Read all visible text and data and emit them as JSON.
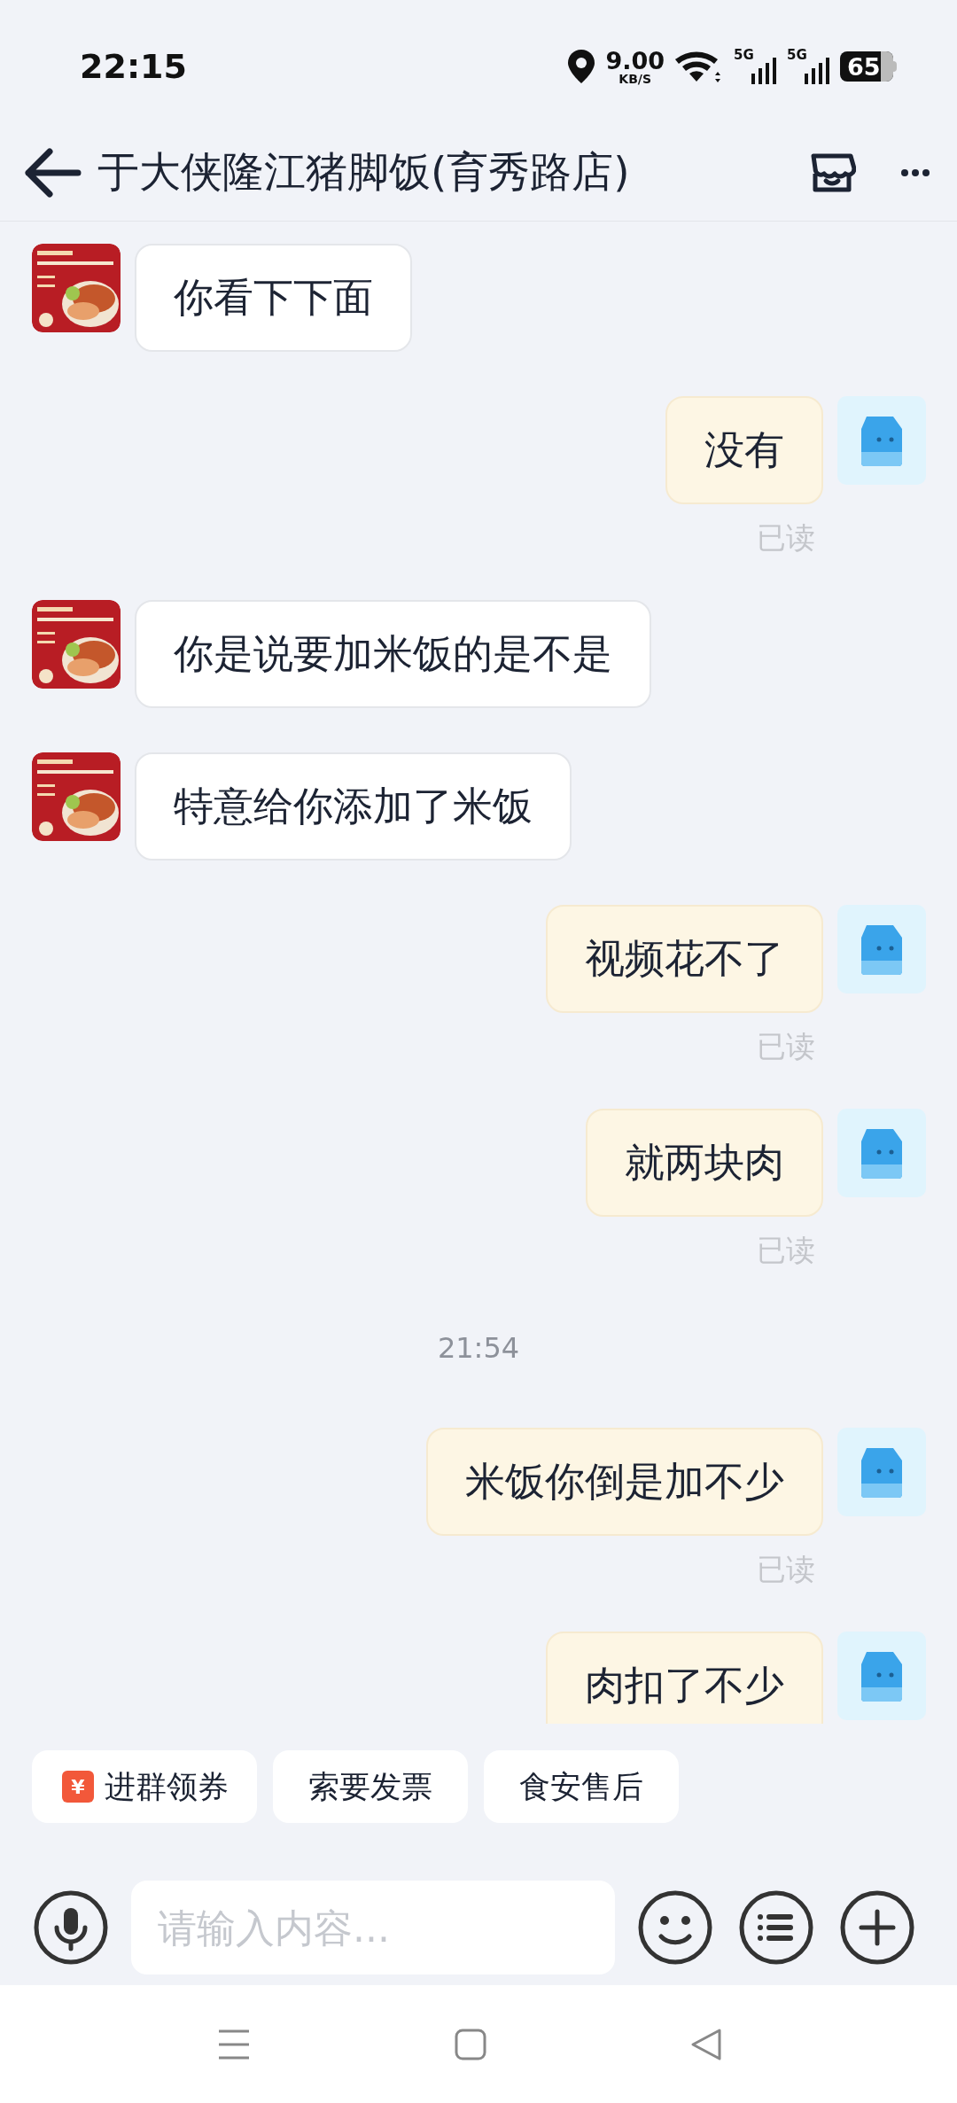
{
  "status_bar": {
    "time": "22:15",
    "net_speed": "9.00",
    "net_unit": "KB/S",
    "networks": [
      "5G",
      "5G"
    ],
    "battery": "65"
  },
  "header": {
    "title": "于大侠隆江猪脚饭(育秀路店)"
  },
  "messages": [
    {
      "kind": "received",
      "text": "你看下下面"
    },
    {
      "kind": "sent",
      "text": "没有",
      "receipt": "已读"
    },
    {
      "kind": "received",
      "text": "你是说要加米饭的是不是"
    },
    {
      "kind": "received",
      "text": "特意给你添加了米饭"
    },
    {
      "kind": "sent",
      "text": "视频花不了",
      "receipt": "已读"
    },
    {
      "kind": "sent",
      "text": "就两块肉",
      "receipt": "已读"
    },
    {
      "kind": "time",
      "text": "21:54"
    },
    {
      "kind": "sent",
      "text": "米饭你倒是加不少",
      "receipt": "已读"
    },
    {
      "kind": "sent",
      "text": "肉扣了不少"
    }
  ],
  "quick_actions": [
    {
      "kind": "coupon",
      "label": "进群领券",
      "icon_text": "¥"
    },
    {
      "kind": "plain",
      "label": "索要发票"
    },
    {
      "kind": "plain",
      "label": "食安售后"
    }
  ],
  "composer": {
    "placeholder": "请输入内容..."
  }
}
